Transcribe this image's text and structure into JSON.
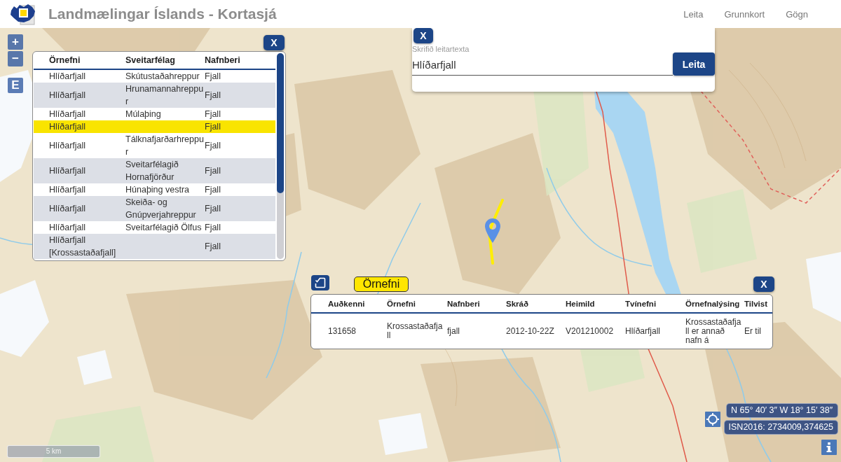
{
  "header": {
    "title": "Landmælingar Íslands - Kortasjá",
    "nav": [
      "Leita",
      "Grunnkort",
      "Gögn"
    ]
  },
  "map_controls": {
    "zoom_in": "+",
    "zoom_out": "−",
    "extent": "E"
  },
  "results_panel": {
    "close": "X",
    "columns": [
      "Örnefni",
      "Sveitarfélag",
      "Nafnberi"
    ],
    "rows": [
      {
        "name": "Hlíðarfjall",
        "municipality": "Skútustaðahreppur",
        "type": "Fjall",
        "selected": false
      },
      {
        "name": "Hlíðarfjall",
        "municipality": "Hrunamannahreppur",
        "type": "Fjall",
        "selected": false
      },
      {
        "name": "Hlíðarfjall",
        "municipality": "Múlaþing",
        "type": "Fjall",
        "selected": false
      },
      {
        "name": "Hlíðarfjall",
        "type": "Fjall",
        "selected": true
      },
      {
        "name": "Hlíðarfjall",
        "municipality": "Tálknafjarðarhreppur",
        "type": "Fjall",
        "selected": false
      },
      {
        "name": "Hlíðarfjall",
        "municipality": "Sveitarfélagið Hornafjörður",
        "type": "Fjall",
        "selected": false
      },
      {
        "name": "Hlíðarfjall",
        "municipality": "Húnaþing vestra",
        "type": "Fjall",
        "selected": false
      },
      {
        "name": "Hlíðarfjall",
        "municipality": "Skeiða- og Gnúpverjahreppur",
        "type": "Fjall",
        "selected": false
      },
      {
        "name": "Hlíðarfjall",
        "municipality": "Sveitarfélagið Ölfus",
        "type": "Fjall",
        "selected": false
      },
      {
        "name": "Hlíðarfjall [Krossastaðafjall]",
        "type": "Fjall",
        "selected": false
      }
    ]
  },
  "search_panel": {
    "close": "X",
    "label": "Skrifið leitartexta",
    "value": "Hlíðarfjall",
    "button": "Leita"
  },
  "detail_panel": {
    "tab": {
      "label": "Örnefni",
      "selected": true
    },
    "close": "X",
    "columns": [
      "Auðkenni",
      "Örnefni",
      "Nafnberi",
      "Skráð",
      "Heimild",
      "Tvínefni",
      "Örnefnalýsing",
      "Tilvist"
    ],
    "rows": [
      [
        "131658",
        "Krossastaðafjall",
        "fjall",
        "2012-10-22Z",
        "V201210002",
        "Hlíðarfjall",
        "Krossastaðafjall er annað nafn á",
        "Er til"
      ]
    ]
  },
  "coordinates": [
    "N 65° 40′ 3″ W 18° 15′ 38″",
    "ISN2016: 2734009,374625"
  ],
  "scale_bar": "5 km"
}
